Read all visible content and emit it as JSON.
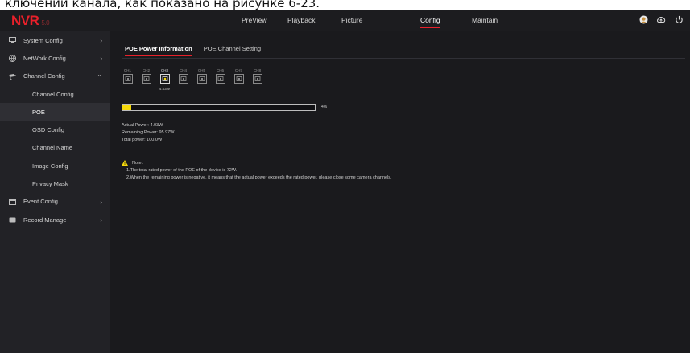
{
  "caption": "ключении канала, как показано на рисунке 6-23.",
  "app": {
    "logo": "NVR",
    "version": "5.0"
  },
  "nav": {
    "items": [
      {
        "label": "PreView",
        "active": false
      },
      {
        "label": "Playback",
        "active": false
      },
      {
        "label": "Picture",
        "active": false
      },
      {
        "label": "Config",
        "active": true
      },
      {
        "label": "Maintain",
        "active": false
      }
    ],
    "icons": [
      "user-icon",
      "cloud-icon",
      "power-icon"
    ]
  },
  "sidebar": {
    "items": [
      {
        "label": "System Config",
        "icon": "monitor-icon",
        "chevron": "›"
      },
      {
        "label": "NetWork Config",
        "icon": "globe-icon",
        "chevron": "›"
      },
      {
        "label": "Channel Config",
        "icon": "camera-icon",
        "chevron": "⌄"
      },
      {
        "label": "Channel Config",
        "sub": true
      },
      {
        "label": "POE",
        "sub": true,
        "active": true
      },
      {
        "label": "OSD Config",
        "sub": true
      },
      {
        "label": "Channel Name",
        "sub": true
      },
      {
        "label": "Image Config",
        "sub": true
      },
      {
        "label": "Privacy Mask",
        "sub": true
      },
      {
        "label": "Event Config",
        "icon": "calendar-icon",
        "chevron": "›"
      },
      {
        "label": "Record Manage",
        "icon": "record-icon",
        "chevron": "›"
      }
    ]
  },
  "tabs": [
    {
      "label": "POE Power Information",
      "active": true
    },
    {
      "label": "POE Channel Setting",
      "active": false
    }
  ],
  "channels": [
    {
      "label": "CH1",
      "watt": ""
    },
    {
      "label": "CH2",
      "watt": ""
    },
    {
      "label": "CH3",
      "watt": "4.03W",
      "active": true
    },
    {
      "label": "CH4",
      "watt": ""
    },
    {
      "label": "CH5",
      "watt": ""
    },
    {
      "label": "CH6",
      "watt": ""
    },
    {
      "label": "CH7",
      "watt": ""
    },
    {
      "label": "CH8",
      "watt": ""
    }
  ],
  "power_usage": {
    "percent": 4,
    "percent_label": "4%"
  },
  "stats": {
    "actual": "Actual Power:  4.03W",
    "remaining": "Remaining Power:  95.97W",
    "total": "Total power:   100.0W"
  },
  "note": {
    "title": "Note:",
    "lines": [
      "1.The total rated power of the POE of the device is 72W.",
      "2.When the remaining power is negative, it means that the actual power exceeds the rated power, please close some camera channels."
    ]
  },
  "colors": {
    "accent": "#e8202a",
    "warning": "#f5d90a",
    "bar": "#f5d90a"
  }
}
